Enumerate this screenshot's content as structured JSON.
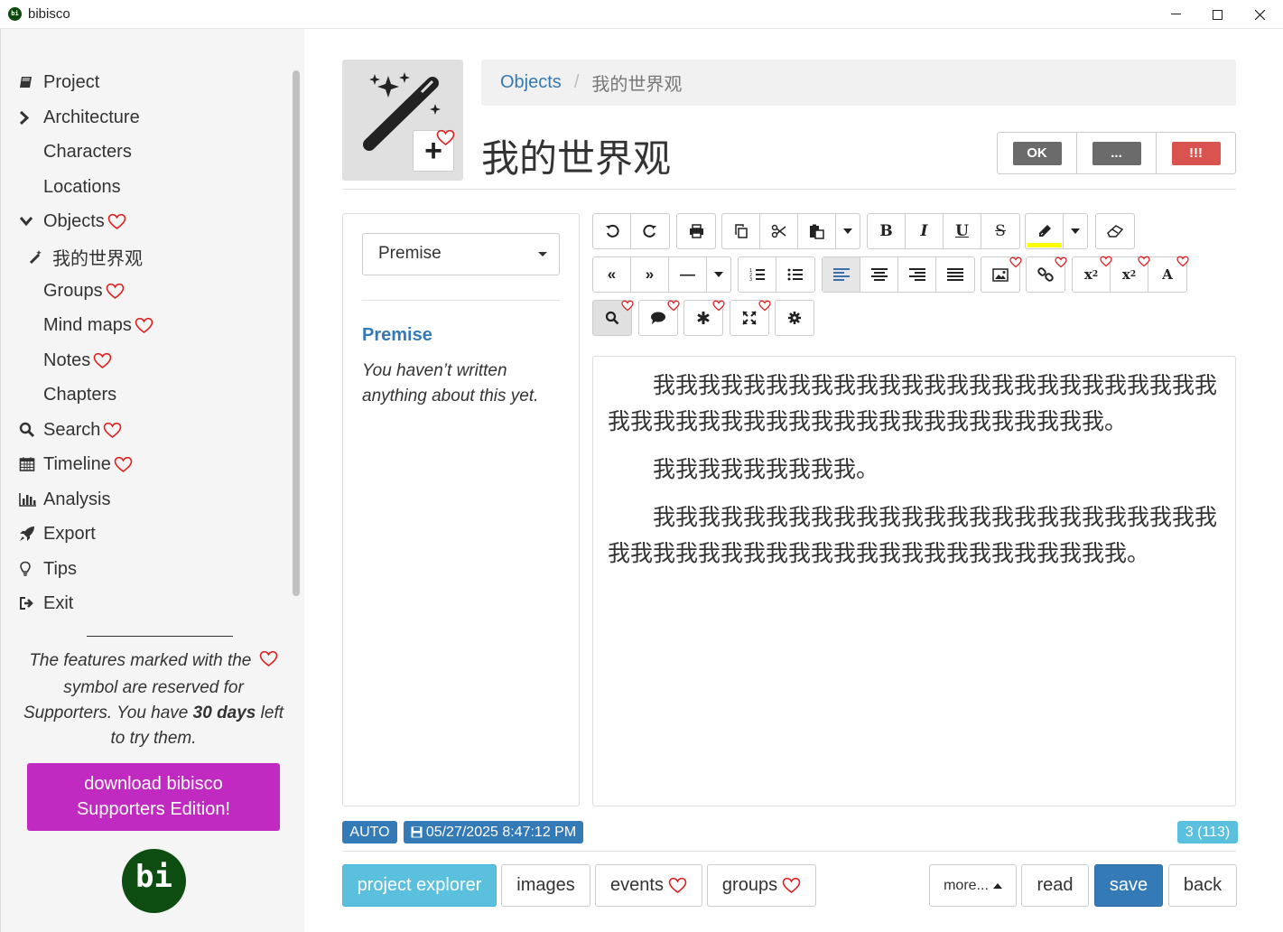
{
  "window": {
    "title": "bibisco",
    "logo_text": "bi",
    "minimize": "–",
    "maximize": "☐",
    "close": "✕"
  },
  "sidebar": {
    "items": [
      {
        "label": "Project"
      },
      {
        "label": "Architecture"
      },
      {
        "label": "Characters"
      },
      {
        "label": "Locations"
      },
      {
        "label": "Objects"
      },
      {
        "label": "我的世界观"
      },
      {
        "label": "Groups"
      },
      {
        "label": "Mind maps"
      },
      {
        "label": "Notes"
      },
      {
        "label": "Chapters"
      },
      {
        "label": "Search"
      },
      {
        "label": "Timeline"
      },
      {
        "label": "Analysis"
      },
      {
        "label": "Export"
      },
      {
        "label": "Tips"
      },
      {
        "label": "Exit"
      }
    ],
    "note_part1": "The features marked with the",
    "note_part2": "symbol are reserved for Supporters. You have",
    "note_days": "30 days",
    "note_part3": "left to try them.",
    "download_line1": "download bibisco",
    "download_line2": "Supporters Edition!",
    "logo_text": "bi"
  },
  "header": {
    "breadcrumb_link": "Objects",
    "breadcrumb_sep": "/",
    "breadcrumb_current": "我的世界观",
    "title": "我的世界观",
    "status": {
      "ok": "OK",
      "progress": "...",
      "todo": "!!!"
    },
    "colors": {
      "ok": "#6b6b6b",
      "progress": "#6b6b6b",
      "todo": "#d9534f"
    }
  },
  "left_panel": {
    "select_value": "Premise",
    "section_title": "Premise",
    "section_text": "You haven’t written anything about this yet."
  },
  "toolbar": {
    "bold": "B",
    "italic": "I",
    "underline": "U",
    "strike": "S",
    "quote_open": "«",
    "quote_close": "»",
    "dash": "—",
    "subscript": "x",
    "sub_mark": "2",
    "superscript": "x",
    "sup_mark": "2",
    "font": "A",
    "highlight_color": "#ffff00"
  },
  "editor": {
    "paragraphs": [
      "我我我我我我我我我我我我我我我我我我我我我我我我我我我我我我我我我我我我我我我我我我我我我我我。",
      "我我我我我我我我我。",
      "我我我我我我我我我我我我我我我我我我我我我我我我我我我我我我我我我我我我我我我我我我我我我我我我。"
    ]
  },
  "footer": {
    "autosave_label": "AUTO",
    "save_time": "05/27/2025 8:47:12 PM",
    "word_count": "3 (113)",
    "badge_color": "#337ab7",
    "count_color": "#5bc0de"
  },
  "buttons": {
    "project_explorer": "project explorer",
    "images": "images",
    "events": "events",
    "groups": "groups",
    "more": "more...",
    "read": "read",
    "save": "save",
    "back": "back"
  }
}
